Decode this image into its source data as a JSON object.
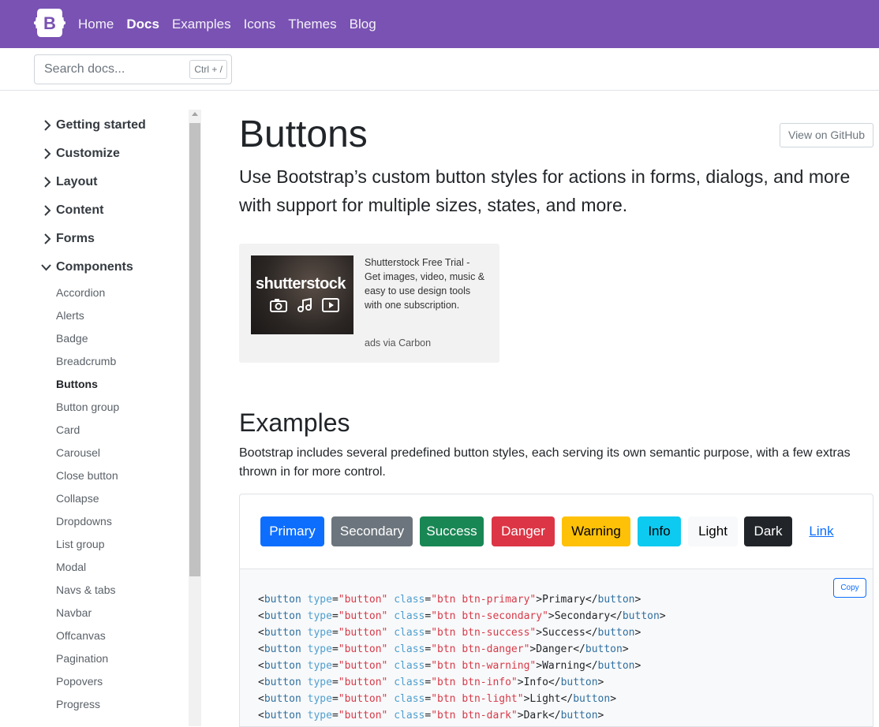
{
  "nav": {
    "logo": "B",
    "links": [
      "Home",
      "Docs",
      "Examples",
      "Icons",
      "Themes",
      "Blog"
    ],
    "active_index": 1
  },
  "search": {
    "placeholder": "Search docs...",
    "shortcut": "Ctrl + /"
  },
  "sidebar": {
    "sections": [
      "Getting started",
      "Customize",
      "Layout",
      "Content",
      "Forms",
      "Components"
    ],
    "expanded_section": "Components",
    "components": [
      "Accordion",
      "Alerts",
      "Badge",
      "Breadcrumb",
      "Buttons",
      "Button group",
      "Card",
      "Carousel",
      "Close button",
      "Collapse",
      "Dropdowns",
      "List group",
      "Modal",
      "Navs & tabs",
      "Navbar",
      "Offcanvas",
      "Pagination",
      "Popovers",
      "Progress"
    ],
    "active_item": "Buttons"
  },
  "page": {
    "title": "Buttons",
    "github_button": "View on GitHub",
    "lead": "Use Bootstrap’s custom button styles for actions in forms, dialogs, and more with support for multiple sizes, states, and more."
  },
  "ad": {
    "brand": "shutterstock",
    "text": "Shutterstock Free Trial - Get images, video, music & easy to use design tools with one subscription.",
    "via": "ads via Carbon"
  },
  "examples": {
    "heading": "Examples",
    "description": "Bootstrap includes several predefined button styles, each serving its own semantic purpose, with a few extras thrown in for more control.",
    "buttons": [
      {
        "label": "Primary",
        "color": "#0d6efd",
        "text_color": "#ffffff"
      },
      {
        "label": "Secondary",
        "color": "#6c757d",
        "text_color": "#ffffff"
      },
      {
        "label": "Success",
        "color": "#198754",
        "text_color": "#ffffff"
      },
      {
        "label": "Danger",
        "color": "#dc3545",
        "text_color": "#ffffff"
      },
      {
        "label": "Warning",
        "color": "#ffc107",
        "text_color": "#000000"
      },
      {
        "label": "Info",
        "color": "#0dcaf0",
        "text_color": "#000000"
      },
      {
        "label": "Light",
        "color": "#f8f9fa",
        "text_color": "#000000"
      },
      {
        "label": "Dark",
        "color": "#212529",
        "text_color": "#ffffff"
      },
      {
        "label": "Link",
        "color": "transparent",
        "text_color": "#0d6efd"
      }
    ],
    "copy_label": "Copy",
    "code": [
      {
        "cls": "btn btn-primary",
        "label": "Primary"
      },
      {
        "cls": "btn btn-secondary",
        "label": "Secondary"
      },
      {
        "cls": "btn btn-success",
        "label": "Success"
      },
      {
        "cls": "btn btn-danger",
        "label": "Danger"
      },
      {
        "cls": "btn btn-warning",
        "label": "Warning"
      },
      {
        "cls": "btn btn-info",
        "label": "Info"
      },
      {
        "cls": "btn btn-light",
        "label": "Light"
      },
      {
        "cls": "btn btn-dark",
        "label": "Dark"
      }
    ]
  },
  "colors": {
    "brand": "#7952b3",
    "link": "#0d6efd"
  }
}
